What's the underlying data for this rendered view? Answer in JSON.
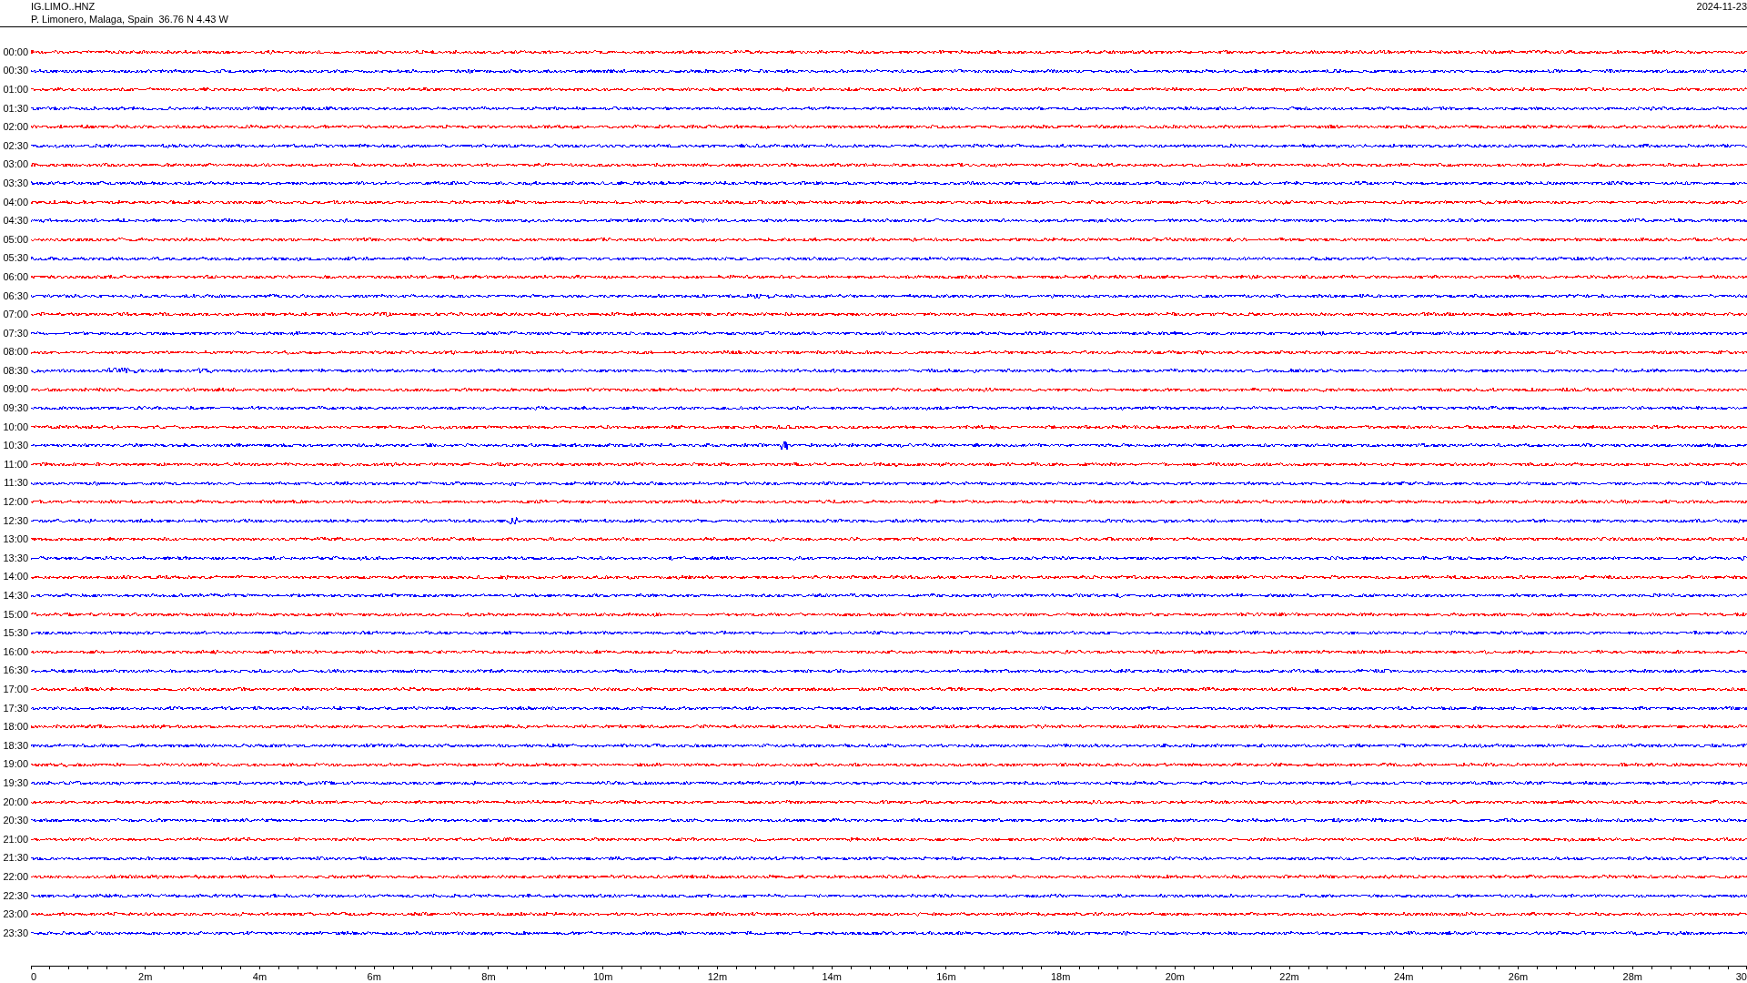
{
  "header": {
    "station": "IG.LIMO..HNZ",
    "location": "P. Limonero, Malaga, Spain  36.76 N 4.43 W",
    "date": "2024-11-23"
  },
  "traces": [
    {
      "time": "00:00",
      "color": "#ff0000"
    },
    {
      "time": "00:30",
      "color": "#0000ff"
    },
    {
      "time": "01:00",
      "color": "#ff0000"
    },
    {
      "time": "01:30",
      "color": "#0000ff"
    },
    {
      "time": "02:00",
      "color": "#ff0000"
    },
    {
      "time": "02:30",
      "color": "#0000ff"
    },
    {
      "time": "03:00",
      "color": "#ff0000"
    },
    {
      "time": "03:30",
      "color": "#0000ff"
    },
    {
      "time": "04:00",
      "color": "#ff0000"
    },
    {
      "time": "04:30",
      "color": "#0000ff"
    },
    {
      "time": "05:00",
      "color": "#ff0000"
    },
    {
      "time": "05:30",
      "color": "#0000ff"
    },
    {
      "time": "06:00",
      "color": "#ff0000"
    },
    {
      "time": "06:30",
      "color": "#0000ff"
    },
    {
      "time": "07:00",
      "color": "#ff0000"
    },
    {
      "time": "07:30",
      "color": "#0000ff"
    },
    {
      "time": "08:00",
      "color": "#ff0000"
    },
    {
      "time": "08:30",
      "color": "#0000ff"
    },
    {
      "time": "09:00",
      "color": "#ff0000"
    },
    {
      "time": "09:30",
      "color": "#0000ff"
    },
    {
      "time": "10:00",
      "color": "#ff0000"
    },
    {
      "time": "10:30",
      "color": "#0000ff"
    },
    {
      "time": "11:00",
      "color": "#ff0000"
    },
    {
      "time": "11:30",
      "color": "#0000ff"
    },
    {
      "time": "12:00",
      "color": "#ff0000"
    },
    {
      "time": "12:30",
      "color": "#0000ff"
    },
    {
      "time": "13:00",
      "color": "#ff0000"
    },
    {
      "time": "13:30",
      "color": "#0000ff"
    },
    {
      "time": "14:00",
      "color": "#ff0000"
    },
    {
      "time": "14:30",
      "color": "#0000ff"
    },
    {
      "time": "15:00",
      "color": "#ff0000"
    },
    {
      "time": "15:30",
      "color": "#0000ff"
    },
    {
      "time": "16:00",
      "color": "#ff0000"
    },
    {
      "time": "16:30",
      "color": "#0000ff"
    },
    {
      "time": "17:00",
      "color": "#ff0000"
    },
    {
      "time": "17:30",
      "color": "#0000ff"
    },
    {
      "time": "18:00",
      "color": "#ff0000"
    },
    {
      "time": "18:30",
      "color": "#0000ff"
    },
    {
      "time": "19:00",
      "color": "#ff0000"
    },
    {
      "time": "19:30",
      "color": "#0000ff"
    },
    {
      "time": "20:00",
      "color": "#ff0000"
    },
    {
      "time": "20:30",
      "color": "#0000ff"
    },
    {
      "time": "21:00",
      "color": "#ff0000"
    },
    {
      "time": "21:30",
      "color": "#0000ff"
    },
    {
      "time": "22:00",
      "color": "#ff0000"
    },
    {
      "time": "22:30",
      "color": "#0000ff"
    },
    {
      "time": "23:00",
      "color": "#ff0000"
    },
    {
      "time": "23:30",
      "color": "#0000ff"
    }
  ],
  "axis": {
    "ticks": [
      "0",
      "2m",
      "4m",
      "6m",
      "8m",
      "10m",
      "12m",
      "14m",
      "16m",
      "18m",
      "20m",
      "22m",
      "24m",
      "26m",
      "28m",
      "30"
    ]
  }
}
